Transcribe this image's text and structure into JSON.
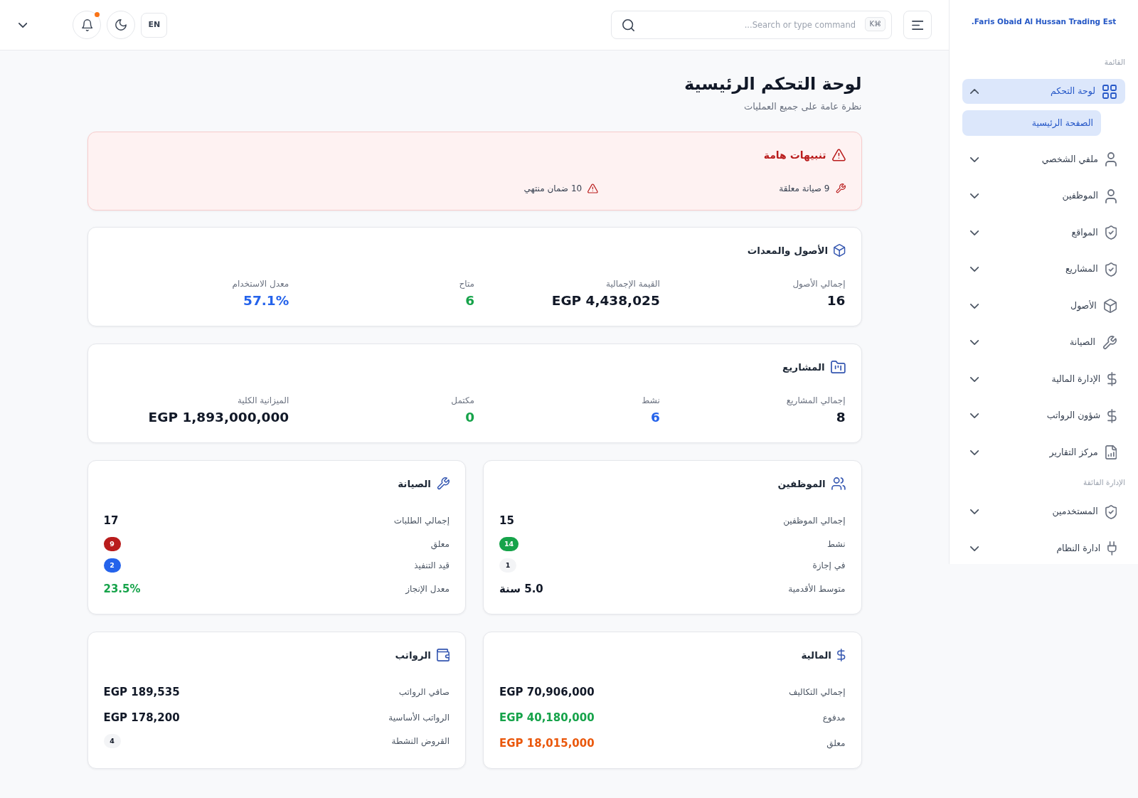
{
  "sidebar": {
    "brand": "Faris Obaid Al Hussan Trading Est.",
    "sections": [
      {
        "title": "القائمة",
        "items": [
          {
            "label": "لوحة التحكم",
            "selected": true,
            "expanded": true,
            "children": [
              {
                "label": "الصفحة الرئيسية",
                "selected": true
              }
            ]
          },
          {
            "label": "ملفي الشخصي",
            "selected": false,
            "expanded": false
          },
          {
            "label": "الموظفين",
            "selected": false,
            "expanded": false
          },
          {
            "label": "المواقع",
            "selected": false,
            "expanded": false
          },
          {
            "label": "المشاريع",
            "selected": false,
            "expanded": false
          },
          {
            "label": "الأصول",
            "selected": false,
            "expanded": false
          },
          {
            "label": "الصيانة",
            "selected": false,
            "expanded": false
          },
          {
            "label": "الإدارة المالية",
            "selected": false,
            "expanded": false
          },
          {
            "label": "شؤون الرواتب",
            "selected": false,
            "expanded": false
          },
          {
            "label": "مركز التقارير",
            "selected": false,
            "expanded": false
          }
        ]
      },
      {
        "title": "الإدارة الفائقة",
        "items": [
          {
            "label": "المستخدمين",
            "selected": false,
            "expanded": false
          },
          {
            "label": "ادارة النظام",
            "selected": false,
            "expanded": false
          }
        ]
      }
    ]
  },
  "topbar": {
    "search": {
      "placeholder": "Search or type command...",
      "shortcut": "⌘K"
    },
    "language": "EN",
    "notifications": {
      "unread": true
    }
  },
  "page": {
    "title": "لوحة التحكم الرئيسية",
    "subtitle": "نظرة عامة على جميع العمليات"
  },
  "alerts": {
    "title": "تنبيهات هامة",
    "items": [
      {
        "text": "9 صيانة معلقة"
      },
      {
        "text": "10 ضمان منتهي"
      }
    ]
  },
  "summary_cards": [
    {
      "title": "الأصول والمعدات",
      "stats": [
        {
          "label": "إجمالي الأصول",
          "value": "16",
          "color": "#111827"
        },
        {
          "label": "القيمة الإجمالية",
          "value": "EGP 4,438,025",
          "color": "#111827"
        },
        {
          "label": "متاح",
          "value": "6",
          "color": "#16a34a"
        },
        {
          "label": "معدل الاستخدام",
          "value": "57.1%",
          "color": "#2563eb"
        }
      ]
    },
    {
      "title": "المشاريع",
      "stats": [
        {
          "label": "إجمالي المشاريع",
          "value": "8",
          "color": "#111827"
        },
        {
          "label": "نشط",
          "value": "6",
          "color": "#2563eb"
        },
        {
          "label": "مكتمل",
          "value": "0",
          "color": "#16a34a"
        },
        {
          "label": "الميزانية الكلية",
          "value": "EGP 1,893,000,000",
          "color": "#111827"
        }
      ]
    }
  ],
  "detail_cards": [
    {
      "title": "الموظفين",
      "rows": [
        {
          "label": "إجمالي الموظفين",
          "value": "15",
          "kind": "text",
          "color": "#111827"
        },
        {
          "label": "نشط",
          "value": "14",
          "kind": "badge",
          "color": "#16a34a"
        },
        {
          "label": "في إجازة",
          "value": "1",
          "kind": "badge",
          "color": "#f3f4f6"
        },
        {
          "label": "متوسط الأقدمية",
          "value": "5.0 سنة",
          "kind": "text",
          "color": "#111827"
        }
      ]
    },
    {
      "title": "الصيانة",
      "rows": [
        {
          "label": "إجمالي الطلبات",
          "value": "17",
          "kind": "text",
          "color": "#111827"
        },
        {
          "label": "معلق",
          "value": "9",
          "kind": "badge",
          "color": "#b91c1c"
        },
        {
          "label": "قيد التنفيذ",
          "value": "2",
          "kind": "badge",
          "color": "#2563eb"
        },
        {
          "label": "معدل الإنجاز",
          "value": "23.5%",
          "kind": "text",
          "color": "#16a34a"
        }
      ]
    },
    {
      "title": "المالية",
      "rows": [
        {
          "label": "إجمالي التكاليف",
          "value": "EGP 70,906,000",
          "kind": "text",
          "color": "#111827"
        },
        {
          "label": "مدفوع",
          "value": "EGP 40,180,000",
          "kind": "text",
          "color": "#16a34a"
        },
        {
          "label": "معلق",
          "value": "EGP 18,015,000",
          "kind": "text",
          "color": "#ea580c"
        }
      ]
    },
    {
      "title": "الرواتب",
      "rows": [
        {
          "label": "صافي الرواتب",
          "value": "EGP 189,535",
          "kind": "text",
          "color": "#111827"
        },
        {
          "label": "الرواتب الأساسية",
          "value": "EGP 178,200",
          "kind": "text",
          "color": "#111827"
        },
        {
          "label": "القروض النشطة",
          "value": "4",
          "kind": "badge",
          "color": "#f3f4f6"
        }
      ]
    }
  ]
}
